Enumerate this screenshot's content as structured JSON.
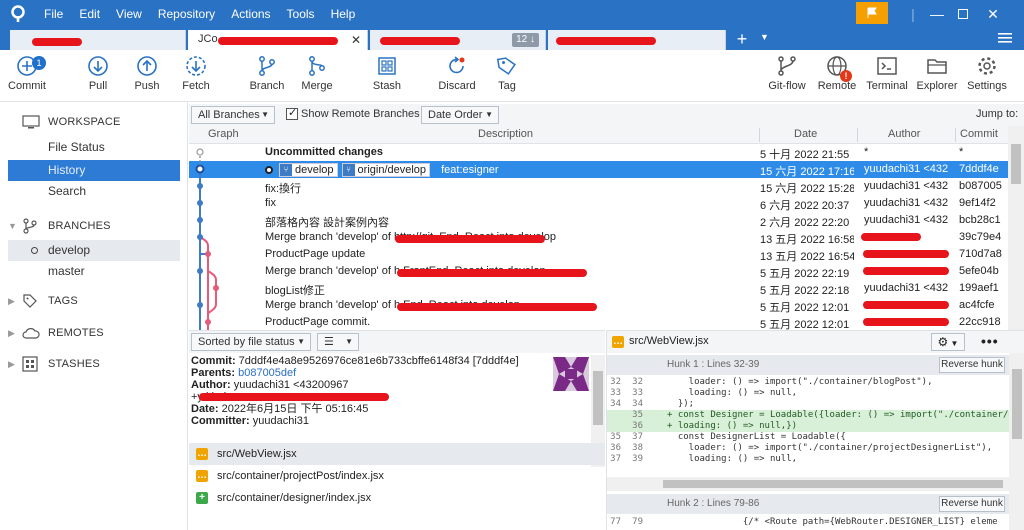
{
  "menu": [
    "File",
    "Edit",
    "View",
    "Repository",
    "Actions",
    "Tools",
    "Help"
  ],
  "tabs": [
    {
      "label": ""
    },
    {
      "label": "JCo"
    },
    {
      "label": "",
      "count": "12 ↓"
    },
    {
      "label": ""
    }
  ],
  "toolbar": {
    "commit": "Commit",
    "commit_badge": "1",
    "pull": "Pull",
    "push": "Push",
    "fetch": "Fetch",
    "branch": "Branch",
    "merge": "Merge",
    "stash": "Stash",
    "discard": "Discard",
    "tag": "Tag",
    "gitflow": "Git-flow",
    "remote": "Remote",
    "remote_badge": "!",
    "terminal": "Terminal",
    "explorer": "Explorer",
    "settings": "Settings"
  },
  "sidebar": {
    "workspace": "WORKSPACE",
    "file_status": "File Status",
    "history": "History",
    "search": "Search",
    "branches": "BRANCHES",
    "branch_develop": "develop",
    "branch_master": "master",
    "tags": "TAGS",
    "remotes": "REMOTES",
    "stashes": "STASHES"
  },
  "filter": {
    "all_branches": "All Branches",
    "show_remote": "Show Remote Branches",
    "date_order": "Date Order",
    "jump_to": "Jump to:"
  },
  "columns": {
    "graph": "Graph",
    "description": "Description",
    "date": "Date",
    "author": "Author",
    "commit": "Commit"
  },
  "commits": [
    {
      "desc": "Uncommitted changes",
      "date": "5 十月 2022 21:55",
      "author": "*",
      "commit": "*"
    },
    {
      "tag1": "develop",
      "tag2": "origin/develop",
      "desc": "feat:esigner",
      "date": "15 六月 2022 17:16",
      "author": "yuudachi31 <432",
      "commit": "7dddf4e"
    },
    {
      "desc": "fix:換行",
      "date": "15 六月 2022 15:28",
      "author": "yuudachi31 <432",
      "commit": "b087005"
    },
    {
      "desc": "fix",
      "date": "6 六月 2022 20:37",
      "author": "yuudachi31 <432",
      "commit": "9ef14f2"
    },
    {
      "desc": "部落格內容 設計案例內容",
      "date": "2 六月 2022 22:20",
      "author": "yuudachi31 <432",
      "commit": "bcb28c1"
    },
    {
      "desc": "Merge branch 'develop' of http://git.               End_React into develop",
      "date": "13 五月 2022 16:58",
      "author": "",
      "commit": "39c79e4"
    },
    {
      "desc": "ProductPage update",
      "date": "13 五月 2022 16:54",
      "author": "",
      "commit": "710d7a8"
    },
    {
      "desc": "Merge branch 'develop' of h                          FrontEnd_React into develop",
      "date": "5 五月 2022 22:19",
      "author": "",
      "commit": "5efe04b"
    },
    {
      "desc": "blogList修正",
      "date": "5 五月 2022 22:18",
      "author": "yuudachi31 <432",
      "commit": "199aef1"
    },
    {
      "desc": "Merge branch 'develop' of h                          End_React into develop",
      "date": "5 五月 2022 12:01",
      "author": "",
      "commit": "ac4fcfe"
    },
    {
      "desc": "ProductPage commit.",
      "date": "5 五月 2022 12:01",
      "author": "",
      "commit": "22cc918"
    }
  ],
  "bottom": {
    "sort": "Sorted by file status",
    "commit_label": "Commit:",
    "commit_value": "7dddf4e4a8e9526976ce81e6b733cbffe6148f34 [7dddf4e]",
    "parents_label": "Parents:",
    "parents_value": "b087005def",
    "author_label": "Author:",
    "author_value": "yuudachi31 <43200967",
    "author_line2": "+y                                          ithub.com>",
    "date_label": "Date:",
    "date_value": "2022年6月15日 下午 05:16:45",
    "committer_label": "Committer:",
    "committer_value": "yuudachi31",
    "files": [
      {
        "name": "src/WebView.jsx",
        "status": "mod"
      },
      {
        "name": "src/container/projectPost/index.jsx",
        "status": "mod"
      },
      {
        "name": "src/container/designer/index.jsx",
        "status": "add"
      }
    ]
  },
  "diff": {
    "file": "src/WebView.jsx",
    "hunk1": "Hunk 1 : Lines 32-39",
    "hunk2": "Hunk 2 : Lines 79-86",
    "reverse": "Reverse hunk",
    "lines": [
      {
        "n1": "32",
        "n2": "32",
        "code": "    loader: () => import(\"./container/blogPost\"),",
        "type": "ctx"
      },
      {
        "n1": "33",
        "n2": "33",
        "code": "    loading: () => null,",
        "type": "ctx"
      },
      {
        "n1": "34",
        "n2": "34",
        "code": "  });",
        "type": "ctx"
      },
      {
        "n1": "",
        "n2": "35",
        "code": "+ const Designer = Loadable({loader: () => import(\"./container/d",
        "type": "add"
      },
      {
        "n1": "",
        "n2": "36",
        "code": "+ loading: () => null,})",
        "type": "add"
      },
      {
        "n1": "35",
        "n2": "37",
        "code": "  const DesignerList = Loadable({",
        "type": "ctx"
      },
      {
        "n1": "36",
        "n2": "38",
        "code": "    loader: () => import(\"./container/projectDesignerList\"),",
        "type": "ctx"
      },
      {
        "n1": "37",
        "n2": "39",
        "code": "    loading: () => null,",
        "type": "ctx"
      }
    ],
    "line2": {
      "n1": "77",
      "n2": "79",
      "code": "              {/* <Route path={WebRouter.DESIGNER_LIST} eleme"
    }
  },
  "colors": {
    "accent": "#2a72c4",
    "selected": "#2e8ce8",
    "flag": "#f5a000"
  }
}
